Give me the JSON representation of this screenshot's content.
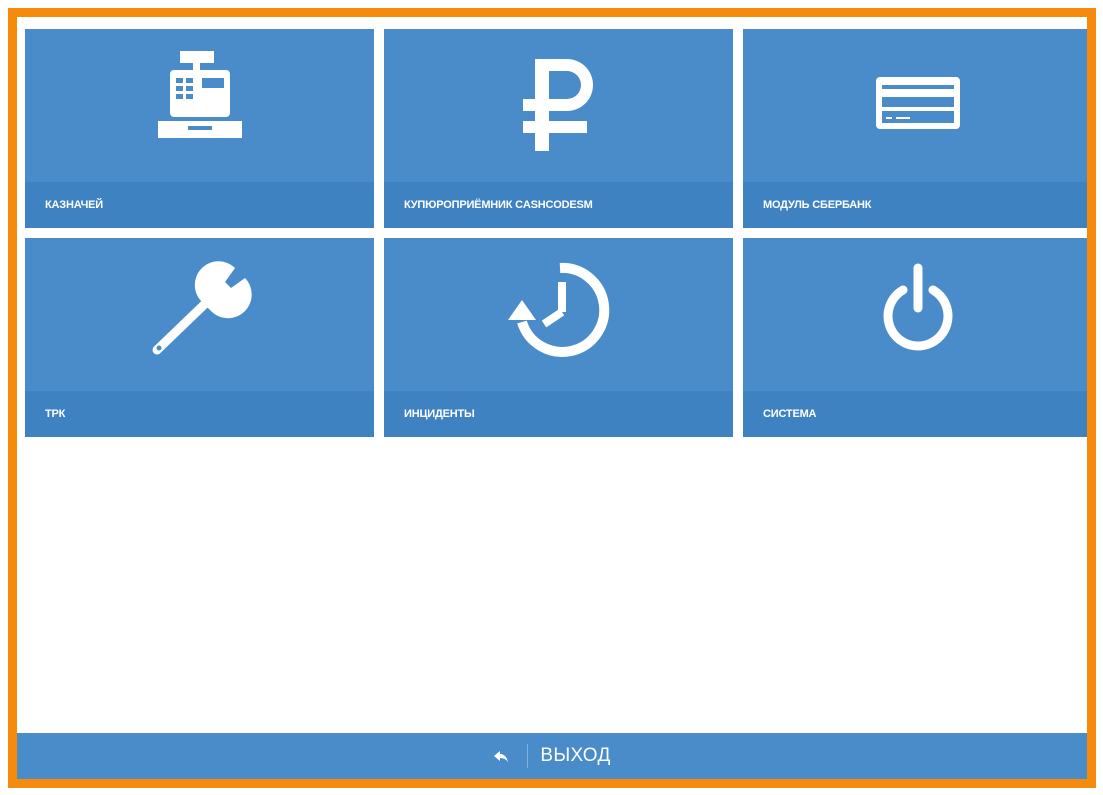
{
  "colors": {
    "frame": "#f58a0c",
    "tile": "#4a8cc9",
    "tile_label_bar": "#3f82c2",
    "footer": "#4a8cc9",
    "text": "#ffffff"
  },
  "tiles": [
    {
      "label": "КАЗНАЧЕЙ",
      "icon": "cash-register-icon"
    },
    {
      "label": "КУПЮРОПРИЁМНИК CASHCODESM",
      "icon": "ruble-icon"
    },
    {
      "label": "МОДУЛЬ СБЕРБАНК",
      "icon": "credit-card-icon"
    },
    {
      "label": "ТРК",
      "icon": "wrench-icon"
    },
    {
      "label": "ИНЦИДЕНТЫ",
      "icon": "history-icon"
    },
    {
      "label": "СИСТЕМА",
      "icon": "power-icon"
    }
  ],
  "footer": {
    "exit_label": "ВЫХОД",
    "exit_icon": "reply-arrow-icon"
  }
}
